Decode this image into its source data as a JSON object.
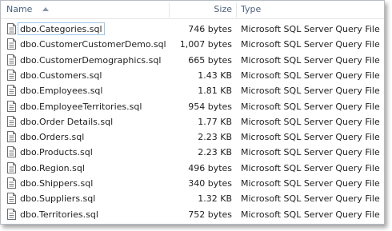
{
  "columns": {
    "name": "Name",
    "size": "Size",
    "type": "Type"
  },
  "files": [
    {
      "name": "dbo.Categories.sql",
      "size": "746 bytes",
      "type": "Microsoft SQL Server Query File"
    },
    {
      "name": "dbo.CustomerCustomerDemo.sql",
      "size": "1,007 bytes",
      "type": "Microsoft SQL Server Query File"
    },
    {
      "name": "dbo.CustomerDemographics.sql",
      "size": "665 bytes",
      "type": "Microsoft SQL Server Query File"
    },
    {
      "name": "dbo.Customers.sql",
      "size": "1.43 KB",
      "type": "Microsoft SQL Server Query File"
    },
    {
      "name": "dbo.Employees.sql",
      "size": "1.81 KB",
      "type": "Microsoft SQL Server Query File"
    },
    {
      "name": "dbo.EmployeeTerritories.sql",
      "size": "954 bytes",
      "type": "Microsoft SQL Server Query File"
    },
    {
      "name": "dbo.Order Details.sql",
      "size": "1.77 KB",
      "type": "Microsoft SQL Server Query File"
    },
    {
      "name": "dbo.Orders.sql",
      "size": "2.23 KB",
      "type": "Microsoft SQL Server Query File"
    },
    {
      "name": "dbo.Products.sql",
      "size": "2.23 KB",
      "type": "Microsoft SQL Server Query File"
    },
    {
      "name": "dbo.Region.sql",
      "size": "496 bytes",
      "type": "Microsoft SQL Server Query File"
    },
    {
      "name": "dbo.Shippers.sql",
      "size": "340 bytes",
      "type": "Microsoft SQL Server Query File"
    },
    {
      "name": "dbo.Suppliers.sql",
      "size": "1.32 KB",
      "type": "Microsoft SQL Server Query File"
    },
    {
      "name": "dbo.Territories.sql",
      "size": "752 bytes",
      "type": "Microsoft SQL Server Query File"
    }
  ],
  "icon": "sql-file-icon",
  "sort": {
    "column": "name",
    "direction": "ascending"
  },
  "colors": {
    "header_text": "#4c607a",
    "focus_border": "#9fc6e8"
  }
}
